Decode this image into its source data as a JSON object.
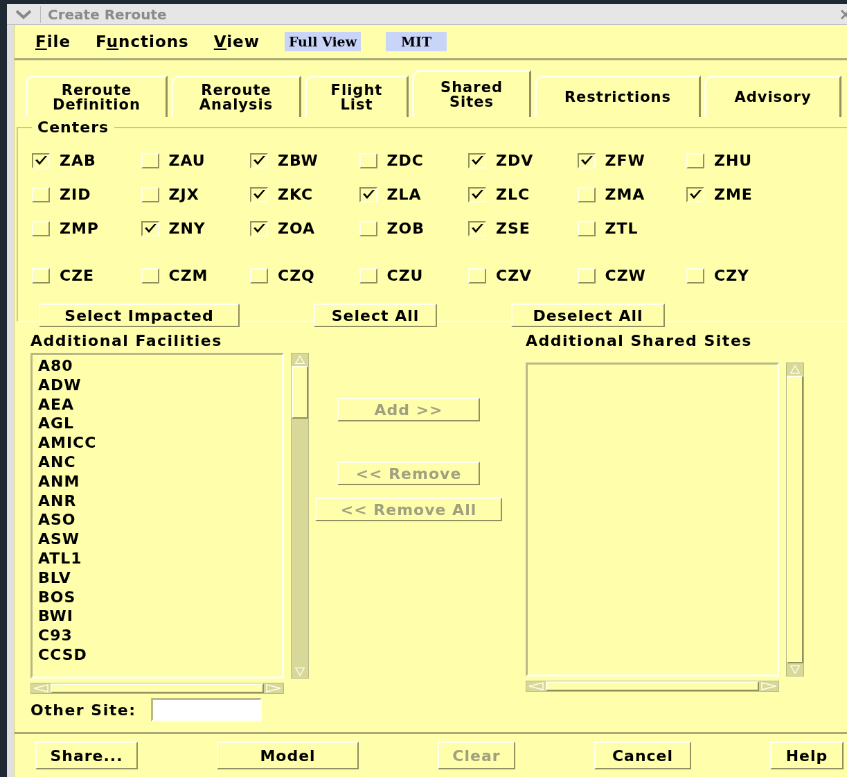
{
  "window": {
    "title": "Create Reroute"
  },
  "menu": [
    {
      "accel": "F",
      "rest": "ile"
    },
    {
      "lead": "F",
      "accel": "u",
      "rest": "nctions"
    },
    {
      "accel": "V",
      "rest": "iew"
    }
  ],
  "view_badges": [
    {
      "label": "Full View"
    },
    {
      "label": "MIT"
    }
  ],
  "tabs": [
    {
      "label": "Reroute\nDefinition",
      "selected": false
    },
    {
      "label": "Reroute\nAnalysis",
      "selected": false
    },
    {
      "label": "Flight\nList",
      "selected": false
    },
    {
      "label": "Shared\nSites",
      "selected": true
    },
    {
      "label": "Restrictions",
      "selected": false
    },
    {
      "label": "Advisory",
      "selected": false
    }
  ],
  "centers": {
    "title": "Centers",
    "rows": [
      [
        {
          "label": "ZAB",
          "checked": true
        },
        {
          "label": "ZAU",
          "checked": false
        },
        {
          "label": "ZBW",
          "checked": true
        },
        {
          "label": "ZDC",
          "checked": false
        },
        {
          "label": "ZDV",
          "checked": true
        },
        {
          "label": "ZFW",
          "checked": true
        },
        {
          "label": "ZHU",
          "checked": false
        }
      ],
      [
        {
          "label": "ZID",
          "checked": false
        },
        {
          "label": "ZJX",
          "checked": false
        },
        {
          "label": "ZKC",
          "checked": true
        },
        {
          "label": "ZLA",
          "checked": true
        },
        {
          "label": "ZLC",
          "checked": true
        },
        {
          "label": "ZMA",
          "checked": false
        },
        {
          "label": "ZME",
          "checked": true
        }
      ],
      [
        {
          "label": "ZMP",
          "checked": false
        },
        {
          "label": "ZNY",
          "checked": true
        },
        {
          "label": "ZOA",
          "checked": true
        },
        {
          "label": "ZOB",
          "checked": false
        },
        {
          "label": "ZSE",
          "checked": true
        },
        {
          "label": "ZTL",
          "checked": false
        }
      ],
      [
        {
          "label": "CZE",
          "checked": false
        },
        {
          "label": "CZM",
          "checked": false
        },
        {
          "label": "CZQ",
          "checked": false
        },
        {
          "label": "CZU",
          "checked": false
        },
        {
          "label": "CZV",
          "checked": false
        },
        {
          "label": "CZW",
          "checked": false
        },
        {
          "label": "CZY",
          "checked": false
        }
      ]
    ],
    "buttons": [
      {
        "label": "Select Impacted",
        "disabled": false
      },
      {
        "label": "Select All",
        "disabled": false
      },
      {
        "label": "Deselect All",
        "disabled": false
      }
    ]
  },
  "additional_facilities": {
    "title": "Additional Facilities",
    "items": [
      "A80",
      "ADW",
      "AEA",
      "AGL",
      "AMICC",
      "ANC",
      "ANM",
      "ANR",
      "ASO",
      "ASW",
      "ATL1",
      "BLV",
      "BOS",
      "BWI",
      "C93",
      "CCSD"
    ]
  },
  "transfer_buttons": [
    {
      "label": "Add >>",
      "disabled": true
    },
    {
      "label": "<< Remove",
      "disabled": true
    },
    {
      "label": "<< Remove All",
      "disabled": true
    }
  ],
  "additional_shared_sites": {
    "title": "Additional Shared Sites"
  },
  "other_site": {
    "label": "Other Site:"
  },
  "bottom_buttons": [
    {
      "label": "Share...",
      "disabled": false
    },
    {
      "label": "Model",
      "disabled": false
    },
    {
      "label": "Clear",
      "disabled": true
    },
    {
      "label": "Cancel",
      "disabled": false
    },
    {
      "label": "Help",
      "disabled": false
    }
  ]
}
